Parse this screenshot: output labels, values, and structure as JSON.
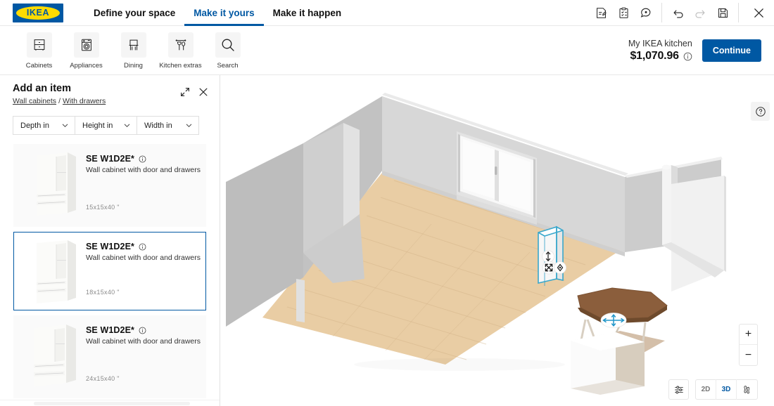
{
  "brand": {
    "name": "IKEA"
  },
  "nav": {
    "tabs": [
      {
        "label": "Define your space",
        "active": false
      },
      {
        "label": "Make it yours",
        "active": true
      },
      {
        "label": "Make it happen",
        "active": false
      }
    ]
  },
  "top_actions": [
    {
      "name": "notes-icon",
      "title": "Notes"
    },
    {
      "name": "clipboard-icon",
      "title": "Shopping list"
    },
    {
      "name": "chat-icon",
      "title": "Feedback"
    },
    {
      "name": "undo-icon",
      "title": "Undo"
    },
    {
      "name": "redo-icon",
      "title": "Redo"
    },
    {
      "name": "save-icon",
      "title": "Save"
    },
    {
      "name": "close-icon",
      "title": "Close"
    }
  ],
  "toolbar": {
    "items": [
      {
        "label": "Cabinets",
        "icon": "cabinet-icon"
      },
      {
        "label": "Appliances",
        "icon": "appliance-icon"
      },
      {
        "label": "Dining",
        "icon": "dining-chair-icon"
      },
      {
        "label": "Kitchen extras",
        "icon": "kitchen-extras-icon"
      },
      {
        "label": "Search",
        "icon": "search-icon"
      }
    ]
  },
  "summary": {
    "project_name": "My IKEA kitchen",
    "price": "$1,070.96",
    "info_icon": "info-icon",
    "continue_label": "Continue"
  },
  "panel": {
    "title": "Add an item",
    "breadcrumb": {
      "root": "Wall cabinets",
      "separator": "/",
      "current": "With drawers"
    },
    "expand_icon": "expand-icon",
    "close_icon": "close-icon",
    "filters": [
      {
        "label": "Depth in"
      },
      {
        "label": "Height in"
      },
      {
        "label": "Width in"
      }
    ],
    "products": [
      {
        "title": "SE W1D2E*",
        "description": "Wall cabinet with door and drawers",
        "dimensions": "15x15x40 \"",
        "selected": false
      },
      {
        "title": "SE W1D2E*",
        "description": "Wall cabinet with door and drawers",
        "dimensions": "18x15x40 \"",
        "selected": true
      },
      {
        "title": "SE W1D2E*",
        "description": "Wall cabinet with door and drawers",
        "dimensions": "24x15x40 \"",
        "selected": false
      }
    ]
  },
  "viewport": {
    "help_icon": "help-icon",
    "zoom_in": "+",
    "zoom_out": "−",
    "settings_icon": "sliders-icon",
    "view_modes": [
      {
        "label": "2D",
        "active": false
      },
      {
        "label": "3D",
        "active": true
      }
    ],
    "walkthrough_icon": "walkthrough-icon",
    "scene": {
      "description": "3D room with gray walls, wood floor, window, selected wall cabinet, dining table and white box",
      "selected_object": "wall cabinet",
      "selection_color": "#39a7cc",
      "gizmo_color": "#2196c9",
      "floor_color": "#e8cfa8",
      "wall_color": "#d6d6d6"
    }
  },
  "colors": {
    "ikea_blue": "#0058a3",
    "ikea_yellow": "#ffdb00",
    "accent": "#0058a3"
  }
}
